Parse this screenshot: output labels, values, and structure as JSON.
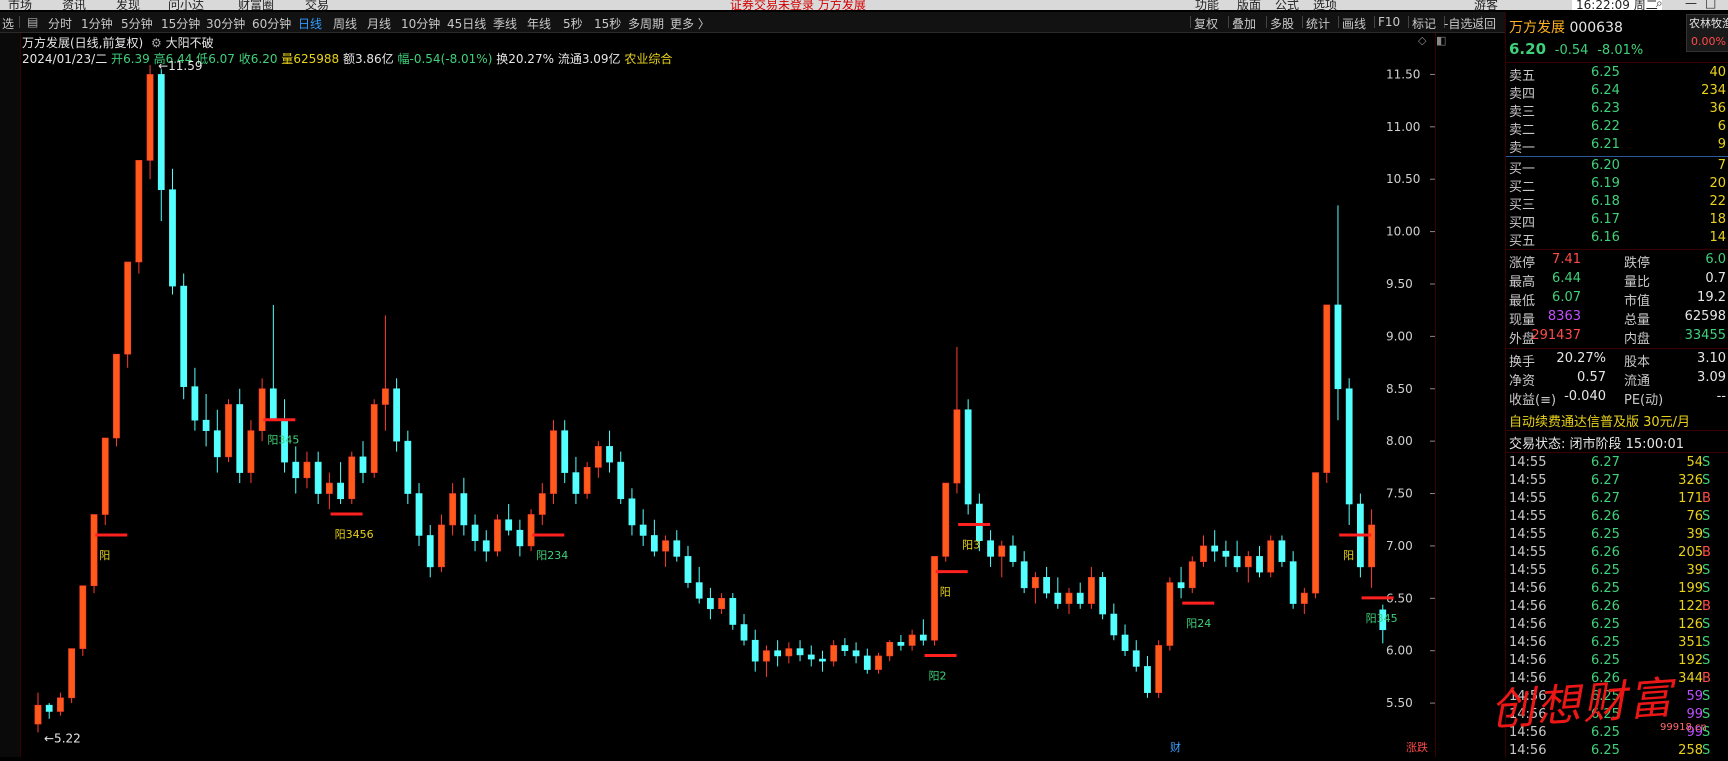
{
  "menubar": {
    "left_items": [
      "市场",
      "资讯",
      "发现",
      "问小达",
      "财富圈",
      "交易"
    ],
    "notice": "证券交易未登录  万方发展",
    "right_items": [
      "功能",
      "版面",
      "公式",
      "选项",
      "游客"
    ],
    "clock": "16:22:09 周二"
  },
  "period_bar": {
    "left_label": "选",
    "items": [
      "分时",
      "1分钟",
      "5分钟",
      "15分钟",
      "30分钟",
      "60分钟",
      "日线",
      "周线",
      "月线",
      "10分钟",
      "45日线",
      "季线",
      "年线",
      "5秒",
      "15秒",
      "多周期",
      "更多 〉"
    ],
    "active": "日线",
    "tools": [
      "复权",
      "叠加",
      "多股",
      "统计",
      "画线",
      "F10",
      "标记",
      "-自选",
      "返回"
    ]
  },
  "chart_header": {
    "title": "万方发展(日线,前复权)",
    "indicator": "大阳不破",
    "date": "2024/01/23/二",
    "open_label": "开",
    "open": "6.39",
    "high_label": "高",
    "high": "6.44",
    "low_label": "低",
    "low": "6.07",
    "close_label": "收",
    "close": "6.20",
    "vol_label": "量",
    "vol": "625988",
    "amt": "额3.86亿",
    "amp": "幅-0.54(-8.01%)",
    "turnover": "换20.27%",
    "float": "流通3.09亿",
    "sector": "农业综合"
  },
  "chart_data": {
    "type": "candlestick",
    "price_ticks": [
      "11.50",
      "11.00",
      "10.50",
      "10.00",
      "9.50",
      "9.00",
      "8.50",
      "8.00",
      "7.50",
      "7.00",
      "6.50",
      "6.00",
      "5.50"
    ],
    "ylim": [
      5.1,
      11.8
    ],
    "high_label": "11.59",
    "low_label": "5.22",
    "signal_labels": [
      "阳",
      "阳345",
      "阳3456",
      "阳234",
      "阳",
      "阳2",
      "阳3",
      "阳24",
      "阳",
      "阳345"
    ],
    "bottom_markers": [
      "财",
      "涨跌"
    ],
    "candles": [
      [
        5.3,
        5.6,
        5.22,
        5.48
      ],
      [
        5.48,
        5.5,
        5.35,
        5.42
      ],
      [
        5.42,
        5.6,
        5.38,
        5.55
      ],
      [
        5.55,
        6.02,
        5.5,
        6.02
      ],
      [
        6.02,
        6.62,
        5.95,
        6.62
      ],
      [
        6.62,
        7.3,
        6.55,
        7.3
      ],
      [
        7.3,
        8.03,
        7.2,
        8.03
      ],
      [
        8.03,
        8.83,
        7.95,
        8.83
      ],
      [
        8.83,
        9.71,
        8.7,
        9.71
      ],
      [
        9.71,
        10.68,
        9.6,
        10.68
      ],
      [
        10.68,
        11.59,
        10.5,
        11.5
      ],
      [
        11.5,
        11.55,
        10.1,
        10.4
      ],
      [
        10.4,
        10.6,
        9.4,
        9.48
      ],
      [
        9.48,
        9.6,
        8.4,
        8.52
      ],
      [
        8.52,
        8.7,
        8.1,
        8.2
      ],
      [
        8.2,
        8.45,
        7.95,
        8.1
      ],
      [
        8.1,
        8.3,
        7.7,
        7.85
      ],
      [
        7.85,
        8.4,
        7.8,
        8.35
      ],
      [
        8.35,
        8.5,
        7.6,
        7.7
      ],
      [
        7.7,
        8.2,
        7.6,
        8.1
      ],
      [
        8.1,
        8.6,
        8.0,
        8.5
      ],
      [
        8.5,
        9.3,
        8.3,
        8.2
      ],
      [
        8.2,
        8.4,
        7.7,
        7.8
      ],
      [
        7.8,
        7.95,
        7.5,
        7.65
      ],
      [
        7.65,
        7.9,
        7.55,
        7.8
      ],
      [
        7.8,
        7.9,
        7.4,
        7.5
      ],
      [
        7.5,
        7.7,
        7.35,
        7.6
      ],
      [
        7.6,
        7.8,
        7.4,
        7.45
      ],
      [
        7.45,
        7.9,
        7.4,
        7.85
      ],
      [
        7.85,
        8.0,
        7.6,
        7.7
      ],
      [
        7.7,
        8.4,
        7.65,
        8.35
      ],
      [
        8.35,
        9.2,
        8.1,
        8.5
      ],
      [
        8.5,
        8.6,
        7.9,
        8.0
      ],
      [
        8.0,
        8.1,
        7.4,
        7.5
      ],
      [
        7.5,
        7.6,
        7.0,
        7.1
      ],
      [
        7.1,
        7.2,
        6.7,
        6.8
      ],
      [
        6.8,
        7.3,
        6.75,
        7.2
      ],
      [
        7.2,
        7.6,
        7.1,
        7.5
      ],
      [
        7.5,
        7.65,
        7.1,
        7.2
      ],
      [
        7.2,
        7.3,
        6.95,
        7.05
      ],
      [
        7.05,
        7.15,
        6.85,
        6.95
      ],
      [
        6.95,
        7.3,
        6.9,
        7.25
      ],
      [
        7.25,
        7.4,
        7.1,
        7.15
      ],
      [
        7.15,
        7.25,
        6.9,
        7.0
      ],
      [
        7.0,
        7.35,
        6.95,
        7.3
      ],
      [
        7.3,
        7.6,
        7.2,
        7.5
      ],
      [
        7.5,
        8.2,
        7.4,
        8.1
      ],
      [
        8.1,
        8.2,
        7.6,
        7.7
      ],
      [
        7.7,
        7.85,
        7.4,
        7.5
      ],
      [
        7.5,
        7.8,
        7.45,
        7.75
      ],
      [
        7.75,
        8.0,
        7.65,
        7.95
      ],
      [
        7.95,
        8.1,
        7.7,
        7.8
      ],
      [
        7.8,
        7.9,
        7.4,
        7.45
      ],
      [
        7.45,
        7.55,
        7.1,
        7.2
      ],
      [
        7.2,
        7.35,
        7.0,
        7.1
      ],
      [
        7.1,
        7.25,
        6.9,
        6.95
      ],
      [
        6.95,
        7.1,
        6.8,
        7.05
      ],
      [
        7.05,
        7.15,
        6.85,
        6.9
      ],
      [
        6.9,
        7.0,
        6.6,
        6.65
      ],
      [
        6.65,
        6.8,
        6.45,
        6.5
      ],
      [
        6.5,
        6.6,
        6.3,
        6.4
      ],
      [
        6.4,
        6.55,
        6.35,
        6.5
      ],
      [
        6.5,
        6.55,
        6.2,
        6.25
      ],
      [
        6.25,
        6.35,
        6.05,
        6.1
      ],
      [
        6.1,
        6.2,
        5.8,
        5.9
      ],
      [
        5.9,
        6.05,
        5.75,
        6.0
      ],
      [
        6.0,
        6.1,
        5.85,
        5.95
      ],
      [
        5.95,
        6.08,
        5.88,
        6.02
      ],
      [
        6.02,
        6.1,
        5.9,
        5.96
      ],
      [
        5.96,
        6.05,
        5.85,
        5.92
      ],
      [
        5.92,
        6.0,
        5.8,
        5.9
      ],
      [
        5.9,
        6.1,
        5.85,
        6.05
      ],
      [
        6.05,
        6.12,
        5.95,
        6.0
      ],
      [
        6.0,
        6.08,
        5.88,
        5.95
      ],
      [
        5.95,
        6.02,
        5.78,
        5.82
      ],
      [
        5.82,
        5.98,
        5.78,
        5.95
      ],
      [
        5.95,
        6.1,
        5.9,
        6.08
      ],
      [
        6.08,
        6.15,
        6.0,
        6.05
      ],
      [
        6.05,
        6.2,
        6.0,
        6.15
      ],
      [
        6.15,
        6.3,
        6.05,
        6.1
      ],
      [
        6.1,
        6.9,
        6.05,
        6.9
      ],
      [
        6.9,
        7.6,
        6.85,
        7.6
      ],
      [
        7.6,
        8.9,
        7.5,
        8.3
      ],
      [
        8.3,
        8.4,
        7.3,
        7.4
      ],
      [
        7.4,
        7.5,
        6.95,
        7.05
      ],
      [
        7.05,
        7.15,
        6.8,
        6.9
      ],
      [
        6.9,
        7.05,
        6.7,
        7.0
      ],
      [
        7.0,
        7.1,
        6.8,
        6.85
      ],
      [
        6.85,
        6.95,
        6.55,
        6.6
      ],
      [
        6.6,
        6.75,
        6.45,
        6.7
      ],
      [
        6.7,
        6.8,
        6.5,
        6.55
      ],
      [
        6.55,
        6.7,
        6.4,
        6.45
      ],
      [
        6.45,
        6.6,
        6.35,
        6.55
      ],
      [
        6.55,
        6.65,
        6.4,
        6.45
      ],
      [
        6.45,
        6.8,
        6.4,
        6.7
      ],
      [
        6.7,
        6.75,
        6.3,
        6.35
      ],
      [
        6.35,
        6.45,
        6.1,
        6.15
      ],
      [
        6.15,
        6.25,
        5.95,
        6.0
      ],
      [
        6.0,
        6.1,
        5.8,
        5.85
      ],
      [
        5.85,
        5.95,
        5.55,
        5.6
      ],
      [
        5.6,
        6.1,
        5.55,
        6.05
      ],
      [
        6.05,
        6.7,
        6.0,
        6.65
      ],
      [
        6.65,
        6.8,
        6.5,
        6.6
      ],
      [
        6.6,
        6.9,
        6.55,
        6.85
      ],
      [
        6.85,
        7.1,
        6.8,
        7.0
      ],
      [
        7.0,
        7.15,
        6.85,
        6.95
      ],
      [
        6.95,
        7.05,
        6.8,
        6.9
      ],
      [
        6.9,
        7.05,
        6.75,
        6.8
      ],
      [
        6.8,
        6.95,
        6.65,
        6.9
      ],
      [
        6.9,
        7.0,
        6.7,
        6.75
      ],
      [
        6.75,
        7.1,
        6.7,
        7.05
      ],
      [
        7.05,
        7.1,
        6.8,
        6.85
      ],
      [
        6.85,
        6.95,
        6.4,
        6.45
      ],
      [
        6.45,
        6.6,
        6.35,
        6.55
      ],
      [
        6.55,
        7.7,
        6.5,
        7.7
      ],
      [
        7.7,
        9.3,
        7.6,
        9.3
      ],
      [
        9.3,
        10.25,
        8.2,
        8.5
      ],
      [
        8.5,
        8.6,
        7.2,
        7.4
      ],
      [
        7.4,
        7.5,
        6.7,
        6.8
      ],
      [
        6.8,
        7.35,
        6.6,
        7.2
      ],
      [
        6.39,
        6.44,
        6.07,
        6.2
      ]
    ]
  },
  "quote": {
    "name": "万方发展",
    "code": "000638",
    "tag": "农林牧渔",
    "tag_pct": "0.00%",
    "price": "6.20",
    "change": "-0.54",
    "change_pct": "-8.01%",
    "asks": [
      {
        "label": "卖五",
        "price": "6.25",
        "vol": "40"
      },
      {
        "label": "卖四",
        "price": "6.24",
        "vol": "234"
      },
      {
        "label": "卖三",
        "price": "6.23",
        "vol": "36"
      },
      {
        "label": "卖二",
        "price": "6.22",
        "vol": "6"
      },
      {
        "label": "卖一",
        "price": "6.21",
        "vol": "9"
      }
    ],
    "bids": [
      {
        "label": "买一",
        "price": "6.20",
        "vol": "7"
      },
      {
        "label": "买二",
        "price": "6.19",
        "vol": "20"
      },
      {
        "label": "买三",
        "price": "6.18",
        "vol": "22"
      },
      {
        "label": "买四",
        "price": "6.17",
        "vol": "18"
      },
      {
        "label": "买五",
        "price": "6.16",
        "vol": "14"
      }
    ],
    "stats": [
      {
        "l1": "涨停",
        "v1": "7.41",
        "l2": "跌停",
        "v2": "6.0"
      },
      {
        "l1": "最高",
        "v1": "6.44",
        "l2": "量比",
        "v2": "0.7"
      },
      {
        "l1": "最低",
        "v1": "6.07",
        "l2": "市值",
        "v2": "19.2"
      },
      {
        "l1": "现量",
        "v1": "8363",
        "l2": "总量",
        "v2": "62598"
      },
      {
        "l1": "外盘",
        "v1": "291437",
        "l2": "内盘",
        "v2": "33455"
      }
    ],
    "stats2": [
      {
        "l1": "换手",
        "v1": "20.27%",
        "l2": "股本",
        "v2": "3.10"
      },
      {
        "l1": "净资",
        "v1": "0.57",
        "l2": "流通",
        "v2": "3.09"
      },
      {
        "l1": "收益(≡)",
        "v1": "-0.040",
        "l2": "PE(动)",
        "v2": "--"
      }
    ],
    "promo": "自动续费通达信普及版  30元/月",
    "status": "交易状态: 闭市阶段 15:00:01",
    "ticks": [
      {
        "t": "14:55",
        "p": "6.27",
        "v": "54",
        "s": "S"
      },
      {
        "t": "14:55",
        "p": "6.27",
        "v": "326",
        "s": "S"
      },
      {
        "t": "14:55",
        "p": "6.27",
        "v": "171",
        "s": "B"
      },
      {
        "t": "14:55",
        "p": "6.26",
        "v": "76",
        "s": "S"
      },
      {
        "t": "14:55",
        "p": "6.25",
        "v": "39",
        "s": "S"
      },
      {
        "t": "14:55",
        "p": "6.26",
        "v": "205",
        "s": "B"
      },
      {
        "t": "14:55",
        "p": "6.25",
        "v": "39",
        "s": "S"
      },
      {
        "t": "14:56",
        "p": "6.25",
        "v": "199",
        "s": "S"
      },
      {
        "t": "14:56",
        "p": "6.26",
        "v": "122",
        "s": "B"
      },
      {
        "t": "14:56",
        "p": "6.25",
        "v": "126",
        "s": "S"
      },
      {
        "t": "14:56",
        "p": "6.25",
        "v": "351",
        "s": "S"
      },
      {
        "t": "14:56",
        "p": "6.25",
        "v": "192",
        "s": "S"
      },
      {
        "t": "14:56",
        "p": "6.26",
        "v": "344",
        "s": "B"
      },
      {
        "t": "14:56",
        "p": "6.25",
        "v": "59",
        "s": "S"
      },
      {
        "t": "14:56",
        "p": "6.25",
        "v": "99",
        "s": "S"
      },
      {
        "t": "14:56",
        "p": "6.25",
        "v": "99",
        "s": "S"
      },
      {
        "t": "14:56",
        "p": "6.25",
        "v": "258",
        "s": "S"
      }
    ]
  },
  "watermark": {
    "text": "创想财富",
    "url": "99918.cn"
  },
  "colors": {
    "up": "#ff4b4b",
    "down": "#3fd17a",
    "bg": "#000000",
    "active": "#2f9cff",
    "signal": "#e8d21a"
  }
}
